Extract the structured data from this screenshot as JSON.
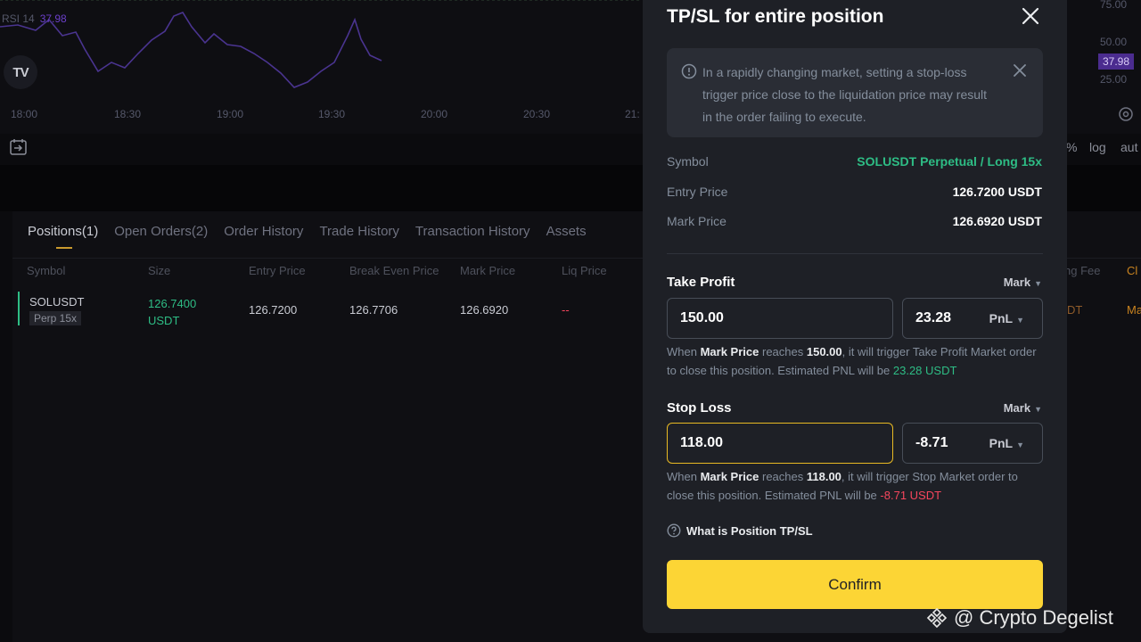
{
  "chart": {
    "rsi_label": "RSI 14",
    "rsi_value": "37.98",
    "tv_logo": "TV",
    "time_ticks": [
      "18:00",
      "18:30",
      "19:00",
      "19:30",
      "20:00",
      "20:30",
      "21:"
    ],
    "axis_ticks": [
      "75.00",
      "50.00",
      "25.00"
    ],
    "axis_badge": "37.98",
    "axis_percent": "%",
    "axis_log": "log",
    "axis_auto": "aut"
  },
  "positions": {
    "tabs": [
      "Positions(1)",
      "Open Orders(2)",
      "Order History",
      "Trade History",
      "Transaction History",
      "Assets"
    ],
    "columns": [
      "Symbol",
      "Size",
      "Entry Price",
      "Break Even Price",
      "Mark Price",
      "Liq Price"
    ],
    "partial_columns": [
      "ng Fee",
      "Cl"
    ],
    "row": {
      "symbol": "SOLUSDT",
      "badge": "Perp  15x",
      "size_value": "126.7400",
      "size_unit": "USDT",
      "entry_price": "126.7200",
      "break_even_price": "126.7706",
      "mark_price": "126.6920",
      "liq_price": "--",
      "partial_fee": "DT",
      "partial_close": "Ma"
    }
  },
  "modal": {
    "title": "TP/SL for entire position",
    "notice": "In a rapidly changing market, setting a stop-loss trigger price close to the liquidation price may result in the order failing to execute.",
    "symbol_label": "Symbol",
    "symbol_value": "SOLUSDT Perpetual / Long 15x",
    "entry_label": "Entry Price",
    "entry_value": "126.7200 USDT",
    "mark_label": "Mark Price",
    "mark_value": "126.6920 USDT",
    "take_profit": {
      "title": "Take Profit",
      "trigger_type": "Mark",
      "price": "150.00",
      "pnl_value": "23.28",
      "pnl_unit": "PnL",
      "hint_prefix": "When",
      "hint_mark": "Mark Price",
      "hint_reaches": "reaches",
      "hint_price": "150.00",
      "hint_rest": ", it will trigger Take Profit Market order to close this position. Estimated PNL will be",
      "hint_pnl": "23.28 USDT"
    },
    "stop_loss": {
      "title": "Stop Loss",
      "trigger_type": "Mark",
      "price": "118.00",
      "pnl_value": "-8.71",
      "pnl_unit": "PnL",
      "hint_prefix": "When",
      "hint_mark": "Mark Price",
      "hint_reaches": "reaches",
      "hint_price": "118.00",
      "hint_rest": ", it will trigger Stop Market order to close this position. Estimated PNL will be",
      "hint_pnl": "-8.71 USDT"
    },
    "help_link": "What is Position TP/SL",
    "confirm_label": "Confirm"
  },
  "watermark": "@ Crypto Degelist",
  "colors": {
    "accent": "#fcd535",
    "green": "#2ebd85",
    "red": "#f6465d",
    "modal_bg": "#1e2026",
    "rsi_line": "#5a3fa8"
  }
}
